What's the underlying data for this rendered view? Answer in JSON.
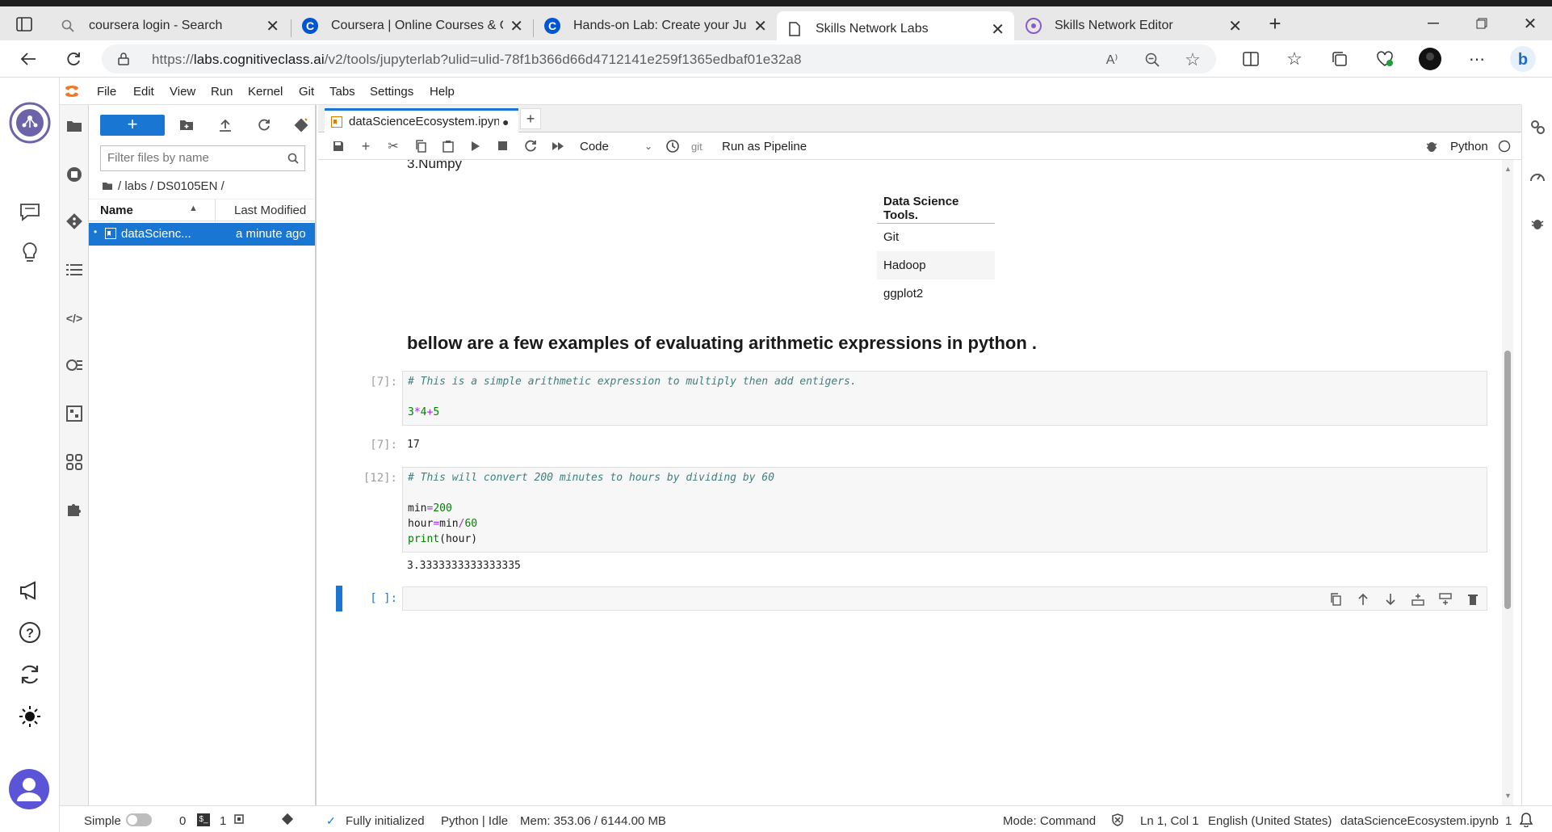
{
  "browser": {
    "tabs": [
      {
        "title": "coursera login - Search",
        "icon": "search-icon"
      },
      {
        "title": "Coursera | Online Courses & Cre",
        "icon": "coursera-icon"
      },
      {
        "title": "Hands-on Lab: Create your Jupyt",
        "icon": "coursera-icon"
      },
      {
        "title": "Skills Network Labs",
        "icon": "page-icon",
        "active": true
      },
      {
        "title": "Skills Network Editor",
        "icon": "skills-network-icon"
      }
    ],
    "url_prefix": "https://",
    "url_domain": "labs.cognitiveclass.ai",
    "url_path": "/v2/tools/jupyterlab?ulid=ulid-78f1b366d66d4712141e259f1365edbaf01e32a8"
  },
  "menubar": [
    "File",
    "Edit",
    "View",
    "Run",
    "Kernel",
    "Git",
    "Tabs",
    "Settings",
    "Help"
  ],
  "filebrowser": {
    "new_label": "+",
    "filter_placeholder": "Filter files by name",
    "breadcrumb": "/ labs / DS0105EN /",
    "col_name": "Name",
    "col_modified": "Last Modified",
    "files": [
      {
        "name": "dataScienc...",
        "modified": "a minute ago"
      }
    ]
  },
  "notebook": {
    "tab_title": "dataScienceEcosystem.ipynb",
    "cell_type": "Code",
    "git_label": "git",
    "run_pipeline": "Run as Pipeline",
    "kernel": "Python",
    "numpy_line": "3.Numpy",
    "table_header": "Data Science Tools.",
    "table_rows": [
      "Git",
      "Hadoop",
      "ggplot2"
    ],
    "heading": "bellow are a few examples of evaluating arithmetic expressions in python .",
    "cells": [
      {
        "prompt": "[7]:",
        "comment": "# This is a simple arithmetic expression to multiply then add entigers.",
        "out_prompt": "[7]:",
        "output": "17"
      },
      {
        "prompt": "[12]:",
        "comment": "# This will convert 200 minutes to hours by dividing by 60",
        "output": "3.3333333333333335"
      }
    ],
    "empty_prompt": "[ ]:"
  },
  "statusbar": {
    "mode_simple": "Simple",
    "count0": "0",
    "count1": "1",
    "init": "Fully initialized",
    "kernel_state": "Python | Idle",
    "mem": "Mem: 353.06 / 6144.00 MB",
    "mode": "Mode: Command",
    "position": "Ln 1, Col 1",
    "language": "English (United States)",
    "filename": "dataScienceEcosystem.ipynb",
    "notifications": "1"
  },
  "colors": {
    "accent": "#1976d2",
    "comment": "#408080",
    "number": "#008000",
    "operator": "#aa22ff"
  }
}
